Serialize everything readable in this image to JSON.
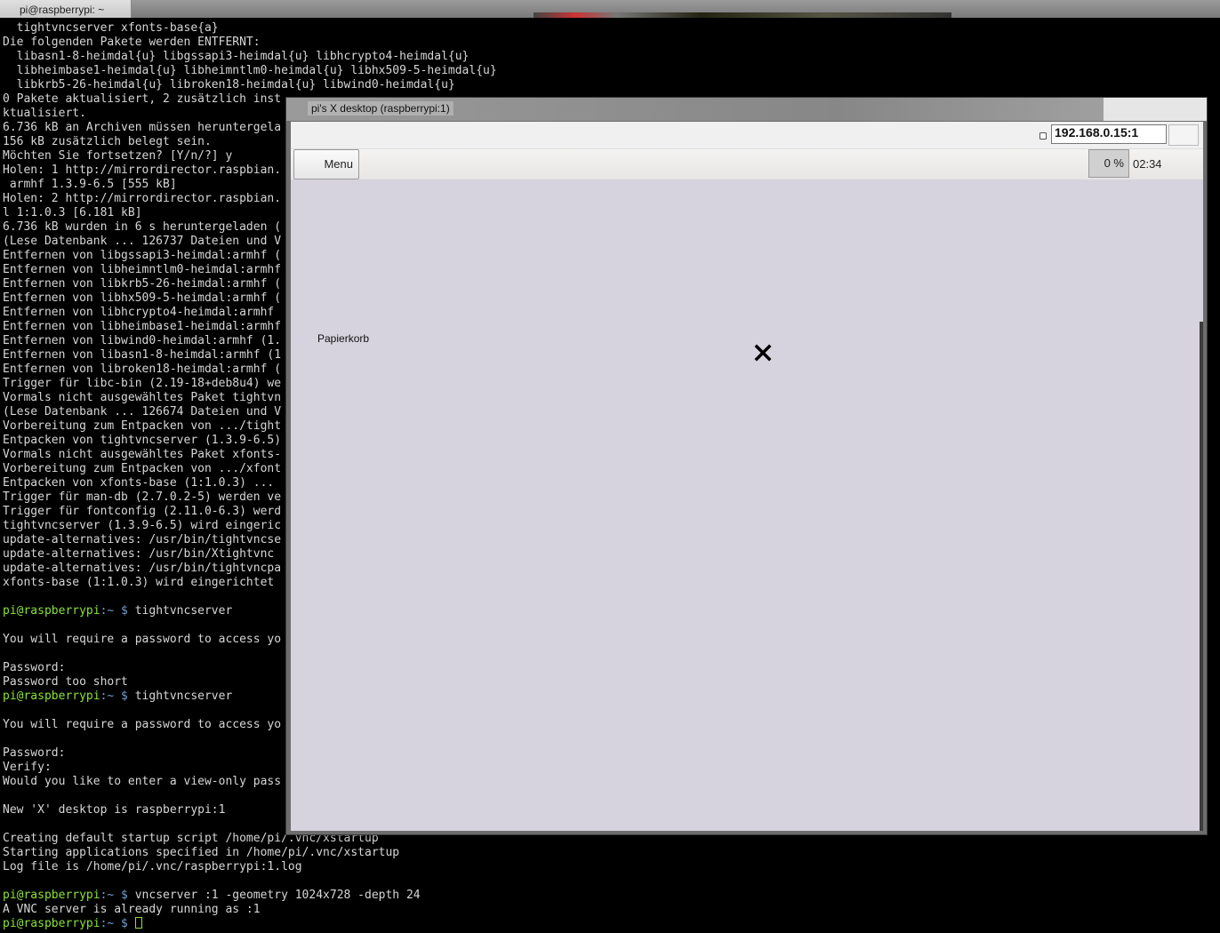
{
  "terminal_tab": {
    "title": "pi@raspberrypi: ~"
  },
  "terminal_lines": [
    {
      "text": "  tightvncserver xfonts-base{a}"
    },
    {
      "text": "Die folgenden Pakete werden ENTFERNT:"
    },
    {
      "text": "  libasn1-8-heimdal{u} libgssapi3-heimdal{u} libhcrypto4-heimdal{u}"
    },
    {
      "text": "  libheimbase1-heimdal{u} libheimntlm0-heimdal{u} libhx509-5-heimdal{u}"
    },
    {
      "text": "  libkrb5-26-heimdal{u} libroken18-heimdal{u} libwind0-heimdal{u}"
    },
    {
      "text": "0 Pakete aktualisiert, 2 zusätzlich inst"
    },
    {
      "text": "ktualisiert."
    },
    {
      "text": "6.736 kB an Archiven müssen heruntergela"
    },
    {
      "text": "156 kB zusätzlich belegt sein."
    },
    {
      "text": "Möchten Sie fortsetzen? [Y/n/?] y"
    },
    {
      "text": "Holen: 1 http://mirrordirector.raspbian."
    },
    {
      "text": " armhf 1.3.9-6.5 [555 kB]"
    },
    {
      "text": "Holen: 2 http://mirrordirector.raspbian."
    },
    {
      "text": "l 1:1.0.3 [6.181 kB]"
    },
    {
      "text": "6.736 kB wurden in 6 s heruntergeladen ("
    },
    {
      "text": "(Lese Datenbank ... 126737 Dateien und V"
    },
    {
      "text": "Entfernen von libgssapi3-heimdal:armhf ("
    },
    {
      "text": "Entfernen von libheimntlm0-heimdal:armhf"
    },
    {
      "text": "Entfernen von libkrb5-26-heimdal:armhf ("
    },
    {
      "text": "Entfernen von libhx509-5-heimdal:armhf ("
    },
    {
      "text": "Entfernen von libhcrypto4-heimdal:armhf"
    },
    {
      "text": "Entfernen von libheimbase1-heimdal:armhf"
    },
    {
      "text": "Entfernen von libwind0-heimdal:armhf (1."
    },
    {
      "text": "Entfernen von libasn1-8-heimdal:armhf (1"
    },
    {
      "text": "Entfernen von libroken18-heimdal:armhf ("
    },
    {
      "text": "Trigger für libc-bin (2.19-18+deb8u4) we"
    },
    {
      "text": "Vormals nicht ausgewähltes Paket tightvn"
    },
    {
      "text": "(Lese Datenbank ... 126674 Dateien und V"
    },
    {
      "text": "Vorbereitung zum Entpacken von .../tight"
    },
    {
      "text": "Entpacken von tightvncserver (1.3.9-6.5)"
    },
    {
      "text": "Vormals nicht ausgewähltes Paket xfonts-"
    },
    {
      "text": "Vorbereitung zum Entpacken von .../xfont"
    },
    {
      "text": "Entpacken von xfonts-base (1:1.0.3) ..."
    },
    {
      "text": "Trigger für man-db (2.7.0.2-5) werden ve"
    },
    {
      "text": "Trigger für fontconfig (2.11.0-6.3) werd"
    },
    {
      "text": "tightvncserver (1.3.9-6.5) wird eingeric"
    },
    {
      "text": "update-alternatives: /usr/bin/tightvncse"
    },
    {
      "text": "update-alternatives: /usr/bin/Xtightvnc "
    },
    {
      "text": "update-alternatives: /usr/bin/tightvncpa"
    },
    {
      "text": "xfonts-base (1:1.0.3) wird eingerichtet "
    },
    {
      "text": ""
    },
    {
      "user": "pi@raspberrypi",
      "path": ":~ $ ",
      "text": "tightvncserver"
    },
    {
      "text": ""
    },
    {
      "text": "You will require a password to access yo"
    },
    {
      "text": ""
    },
    {
      "text": "Password:"
    },
    {
      "text": "Password too short"
    },
    {
      "user": "pi@raspberrypi",
      "path": ":~ $ ",
      "text": "tightvncserver"
    },
    {
      "text": ""
    },
    {
      "text": "You will require a password to access yo"
    },
    {
      "text": ""
    },
    {
      "text": "Password:"
    },
    {
      "text": "Verify:"
    },
    {
      "text": "Would you like to enter a view-only pass"
    },
    {
      "text": ""
    },
    {
      "text": "New 'X' desktop is raspberrypi:1"
    },
    {
      "text": ""
    },
    {
      "text": "Creating default startup script /home/pi/.vnc/xstartup"
    },
    {
      "text": "Starting applications specified in /home/pi/.vnc/xstartup"
    },
    {
      "text": "Log file is /home/pi/.vnc/raspberrypi:1.log"
    },
    {
      "text": ""
    },
    {
      "user": "pi@raspberrypi",
      "path": ":~ $ ",
      "text": "vncserver :1 -geometry 1024x728 -depth 24"
    },
    {
      "text": "A VNC server is already running as :1"
    },
    {
      "user": "pi@raspberrypi",
      "path": ":~ $ ",
      "text": "",
      "cursor": true
    }
  ],
  "vnc": {
    "title": "pi's X desktop (raspberrypi:1)",
    "address": "192.168.0.15:1",
    "panel": {
      "menu_label": "Menu",
      "cpu_label": "0 %",
      "clock": "02:34"
    },
    "desktop": {
      "trash_label": "Papierkorb"
    }
  },
  "colors": {
    "terminal_bg": "#000000",
    "terminal_fg": "#d6d6d6",
    "prompt_user": "#8ae234",
    "prompt_path": "#729fcf",
    "desktop_bg": "#d7d3de"
  }
}
